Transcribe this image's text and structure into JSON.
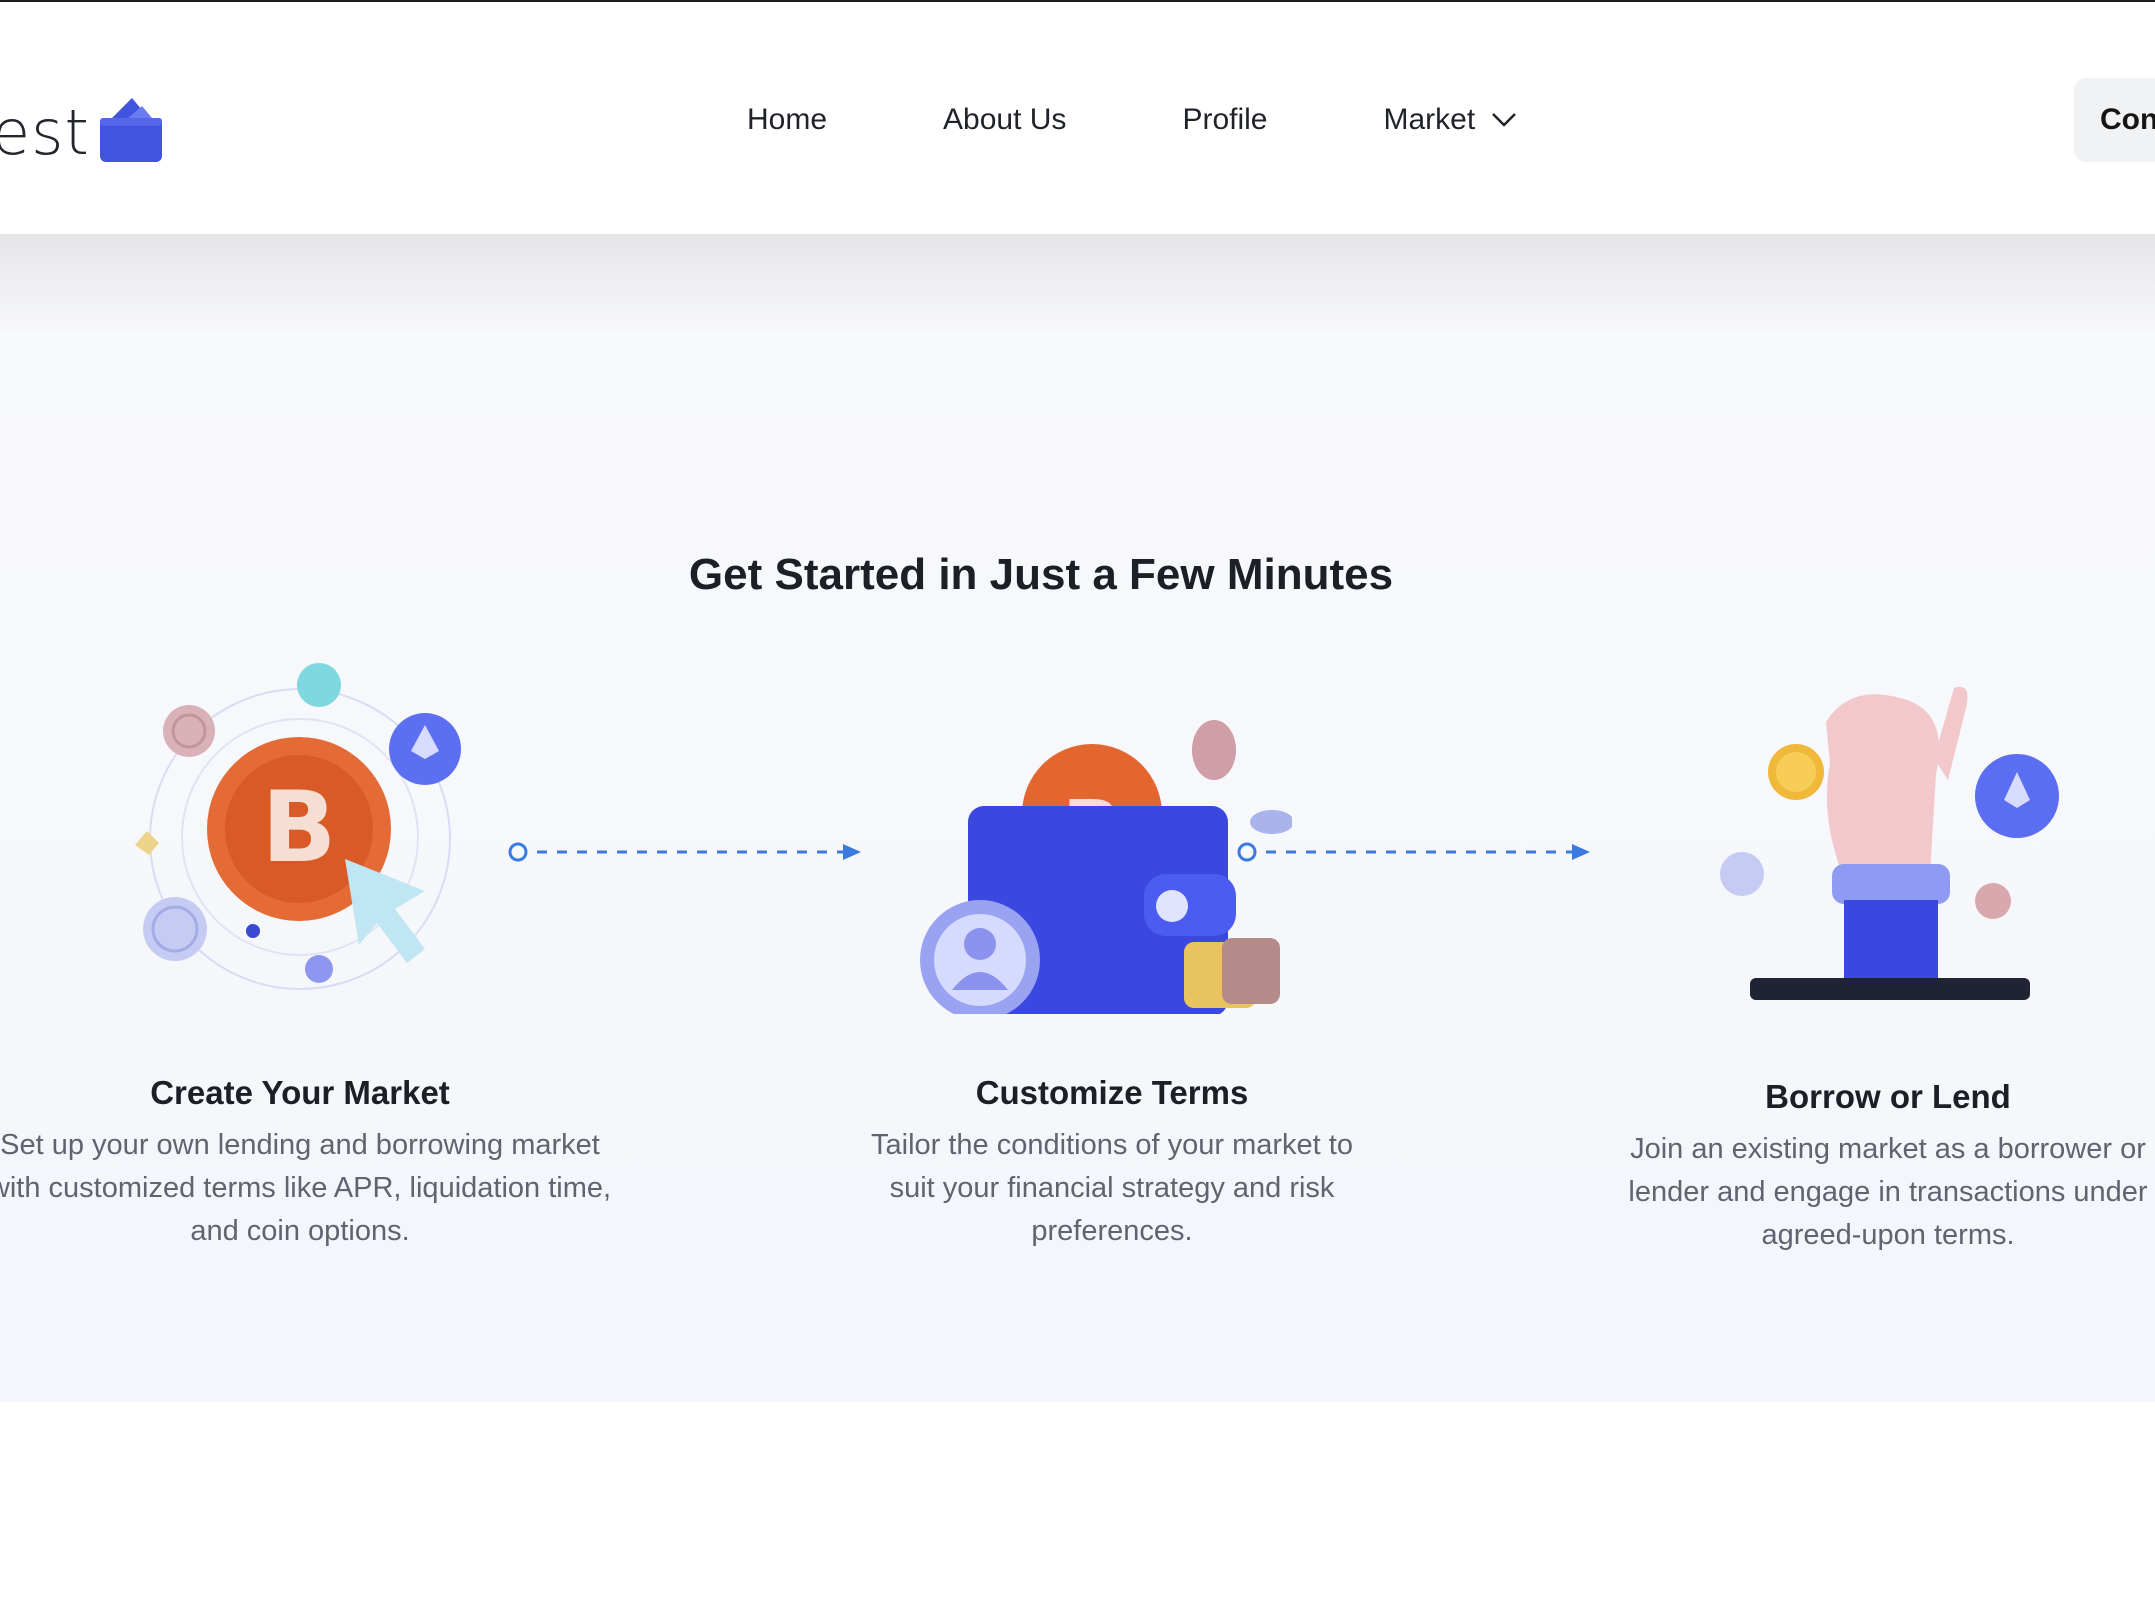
{
  "brand": {
    "logo_text": "est"
  },
  "nav": {
    "items": [
      "Home",
      "About Us",
      "Profile"
    ],
    "market_label": "Market",
    "connect_label": "Con"
  },
  "section": {
    "title": "Get Started in Just a Few Minutes",
    "steps": [
      {
        "title": "Create Your Market",
        "desc_lines": [
          "Set up your own lending and borrowing market",
          "with customized terms like APR, liquidation time,",
          "and coin options."
        ]
      },
      {
        "title": "Customize Terms",
        "desc_lines": [
          "Tailor the conditions of your market to",
          "suit your financial strategy and risk",
          "preferences."
        ]
      },
      {
        "title": "Borrow or Lend",
        "desc_lines": [
          "Join an existing market as a borrower or",
          "lender and engage in transactions under",
          "agreed-upon terms."
        ]
      }
    ]
  },
  "colors": {
    "accent": "#4253e0",
    "bitcoin": "#e0632e",
    "arrow": "#3b7be0"
  }
}
